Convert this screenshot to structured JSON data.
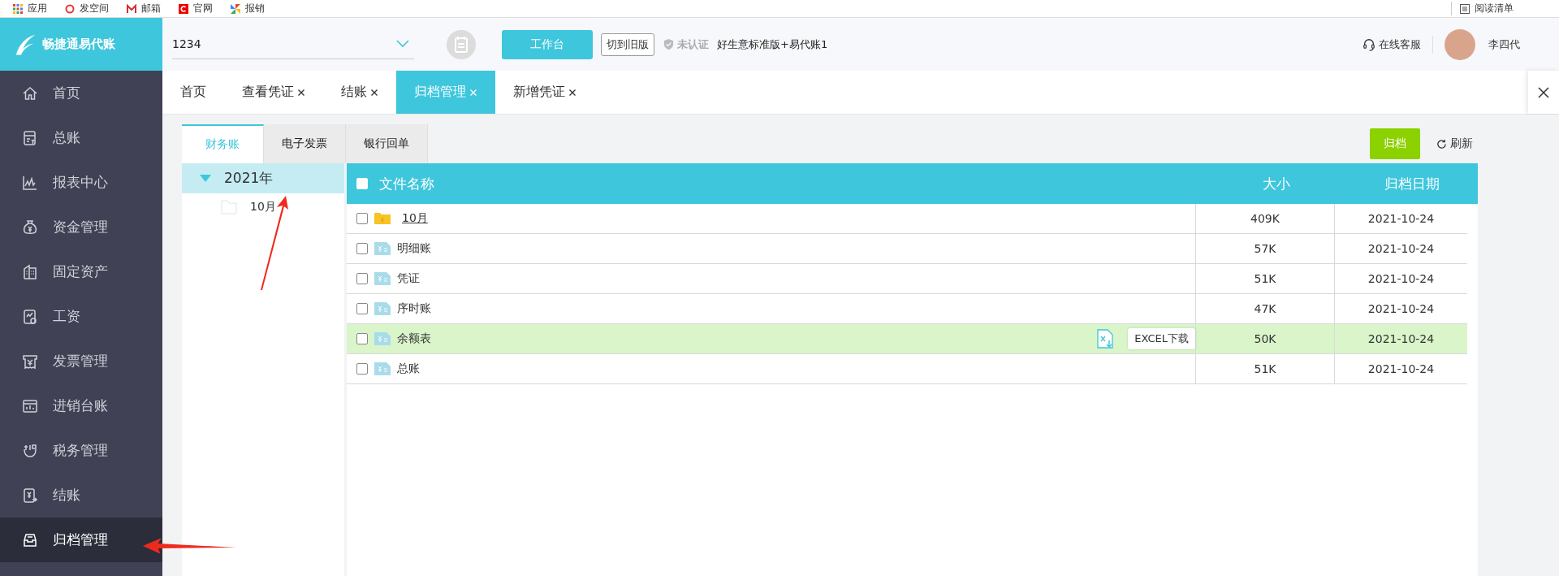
{
  "bookmarks": [
    {
      "label": "应用"
    },
    {
      "label": "发空间"
    },
    {
      "label": "邮箱"
    },
    {
      "label": "官网"
    },
    {
      "label": "报销"
    }
  ],
  "reading_list": "阅读清单",
  "logo": {
    "text": "畅捷通易代账"
  },
  "company_select": {
    "value": "1234"
  },
  "header_buttons": [
    {
      "label": "工作台",
      "kind": "primary"
    },
    {
      "label": "切到旧版",
      "kind": "outline"
    }
  ],
  "certification": {
    "status": "未认证",
    "product": "好生意标准版+易代账1"
  },
  "support": "在线客服",
  "user": {
    "name": "李四代"
  },
  "sidebar": {
    "items": [
      {
        "label": "首页",
        "selected": false
      },
      {
        "label": "总账",
        "selected": false
      },
      {
        "label": "报表中心",
        "selected": false
      },
      {
        "label": "资金管理",
        "selected": false
      },
      {
        "label": "固定资产",
        "selected": false
      },
      {
        "label": "工资",
        "selected": false
      },
      {
        "label": "发票管理",
        "selected": false
      },
      {
        "label": "进销台账",
        "selected": false
      },
      {
        "label": "税务管理",
        "selected": false
      },
      {
        "label": "结账",
        "selected": false
      },
      {
        "label": "归档管理",
        "selected": true
      }
    ]
  },
  "tabs": [
    {
      "label": "首页",
      "closable": false,
      "selected": false
    },
    {
      "label": "查看凭证",
      "closable": true,
      "selected": false
    },
    {
      "label": "结账",
      "closable": true,
      "selected": false
    },
    {
      "label": "归档管理",
      "closable": true,
      "selected": true
    },
    {
      "label": "新增凭证",
      "closable": true,
      "selected": false
    }
  ],
  "toolbar": {
    "archive_button": "归档",
    "refresh": "刷新"
  },
  "sub_tabs": [
    {
      "label": "财务账",
      "selected": true
    },
    {
      "label": "电子发票",
      "selected": false
    },
    {
      "label": "银行回单",
      "selected": false
    }
  ],
  "tree": [
    {
      "label": "2021年",
      "expanded": true,
      "selected": true,
      "children": [
        {
          "label": "10月",
          "selected": false
        }
      ]
    }
  ],
  "table": {
    "all_checked": false,
    "columns": [
      "文件名称",
      "大小",
      "归档日期"
    ],
    "rows": [
      {
        "kind": "folder",
        "name": "10月",
        "size": "409K",
        "date": "2021-10-24",
        "checked": false,
        "highlighted": false
      },
      {
        "kind": "file",
        "name": "明细账",
        "size": "57K",
        "date": "2021-10-24",
        "checked": false,
        "highlighted": false
      },
      {
        "kind": "file",
        "name": "凭证",
        "size": "51K",
        "date": "2021-10-24",
        "checked": false,
        "highlighted": false
      },
      {
        "kind": "file",
        "name": "序时账",
        "size": "47K",
        "date": "2021-10-24",
        "checked": false,
        "highlighted": false
      },
      {
        "kind": "file",
        "name": "余额表",
        "size": "50K",
        "date": "2021-10-24",
        "checked": false,
        "highlighted": true,
        "download_tooltip": "EXCEL下载"
      },
      {
        "kind": "file",
        "name": "总账",
        "size": "51K",
        "date": "2021-10-24",
        "checked": false,
        "highlighted": false
      }
    ]
  }
}
